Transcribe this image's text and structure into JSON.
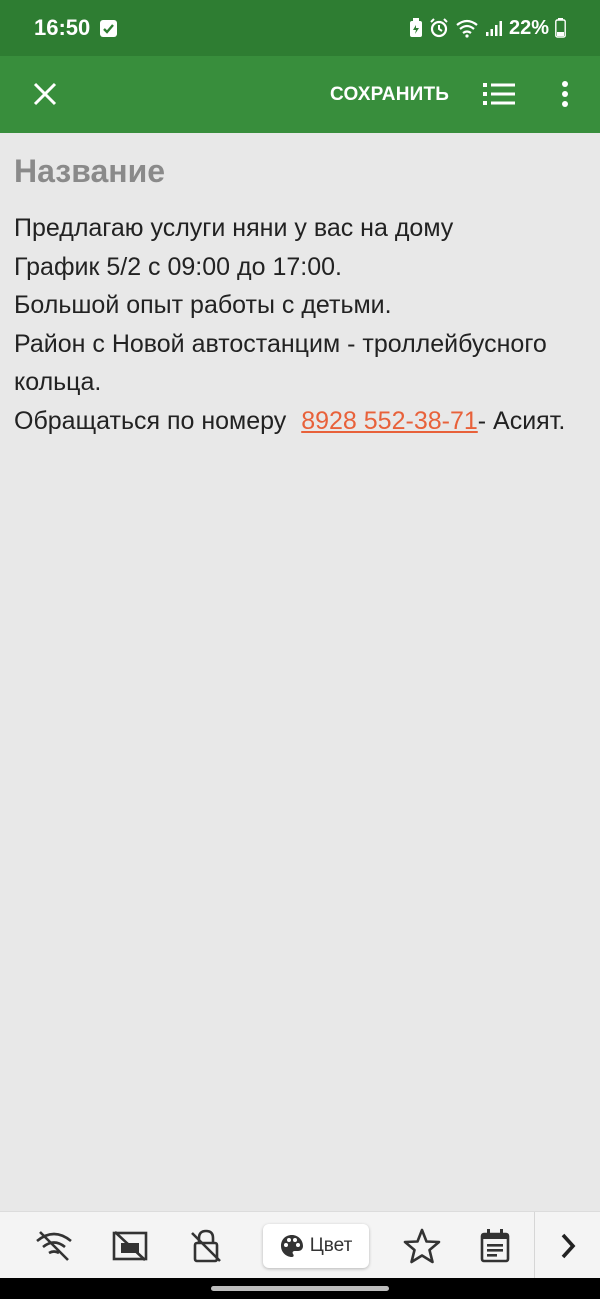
{
  "status_bar": {
    "time": "16:50",
    "battery": "22%",
    "icons": [
      "checkbox-notification-icon",
      "battery-saver-icon",
      "alarm-icon",
      "wifi-icon",
      "signal-icon",
      "battery-icon"
    ]
  },
  "toolbar": {
    "close_icon": "close-icon",
    "save_label": "СОХРАНИТЬ",
    "list_icon": "list-icon",
    "more_icon": "more-vert-icon"
  },
  "note": {
    "title_placeholder": "Название",
    "lines": [
      "Предлагаю услуги няни у вас на дому",
      "График 5/2 с 09:00 до 17:00.",
      "Большой опыт работы с детьми.",
      "Район с Новой автостанцим - троллейбусного кольца."
    ],
    "contact_prefix": "Обращаться по номеру",
    "phone": "8928 552-38-71",
    "contact_suffix": "- Асият."
  },
  "bottom_toolbar": {
    "color_label": "Цвет",
    "icons": [
      "no-sync-icon",
      "hide-preview-icon",
      "lock-off-icon",
      "palette-icon",
      "star-icon",
      "calendar-note-icon",
      "chevron-right-icon"
    ]
  },
  "colors": {
    "status_bar": "#2e7d32",
    "app_bar": "#388e3c",
    "background": "#e8e8e8",
    "link": "#e8613a"
  }
}
